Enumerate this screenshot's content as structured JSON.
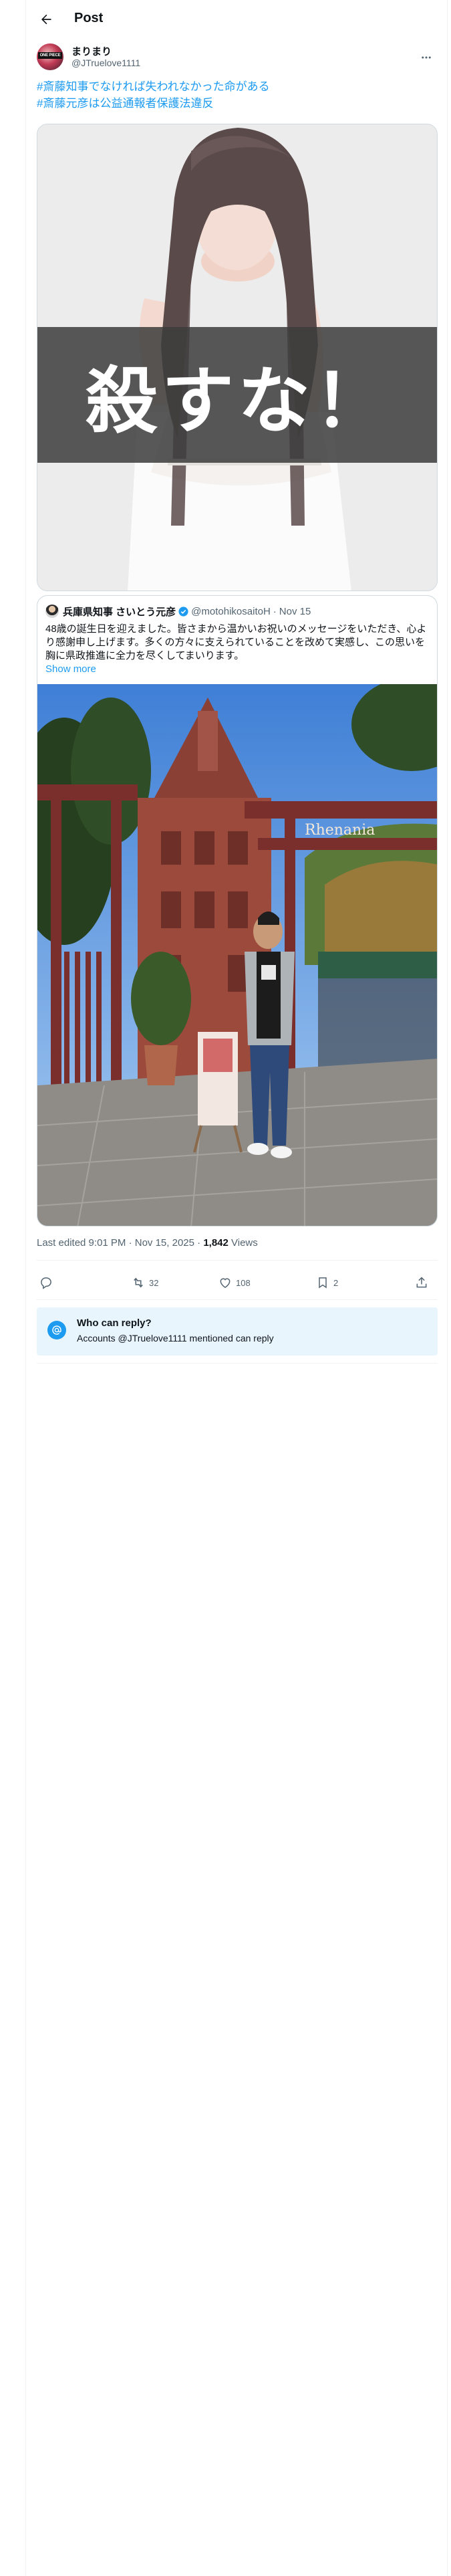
{
  "header": {
    "title": "Post"
  },
  "author": {
    "name": "まりまり",
    "handle": "@JTruelove1111",
    "avatar_text": "ONE PIECE"
  },
  "tweet": {
    "hashtags": [
      "#斎藤知事でなければ失われなかった命がある",
      "#斎藤元彦は公益通報者保護法違反"
    ]
  },
  "media": {
    "overlay_text": "殺すな！"
  },
  "quote": {
    "name": "兵庫県知事 さいとう元彦",
    "handle": "@motohikosaitoH",
    "separator": "·",
    "date": "Nov 15",
    "text": "48歳の誕生日を迎えました。皆さまから温かいお祝いのメッセージをいただき、心より感謝申し上げます。多くの方々に支えられていることを改めて実感し、この思いを胸に県政推進に全力を尽くしてまいります。",
    "show_more": "Show more",
    "photo_sign": "Rhenania"
  },
  "meta": {
    "edited_time": "Last edited 9:01 PM · Nov 15, 2025 · ",
    "views_count": "1,842",
    "views_label": " Views"
  },
  "actions": {
    "replies": "",
    "reposts": "32",
    "likes": "108",
    "bookmarks": "2"
  },
  "reply_restriction": {
    "title": "Who can reply?",
    "description": "Accounts @JTruelove1111 mentioned can reply"
  },
  "colors": {
    "accent": "#1d9bf0",
    "text": "#0f1419",
    "muted": "#536471",
    "border": "#cfd9de",
    "reply_bg": "#e8f5fd"
  },
  "icons": {
    "back": "arrow-left-icon",
    "more": "ellipsis-icon",
    "reply": "speech-bubble-icon",
    "repost": "repost-arrows-icon",
    "like": "heart-icon",
    "bookmark": "bookmark-icon",
    "share": "upload-share-icon",
    "verified": "verified-badge-icon",
    "mention": "at-sign-icon"
  }
}
